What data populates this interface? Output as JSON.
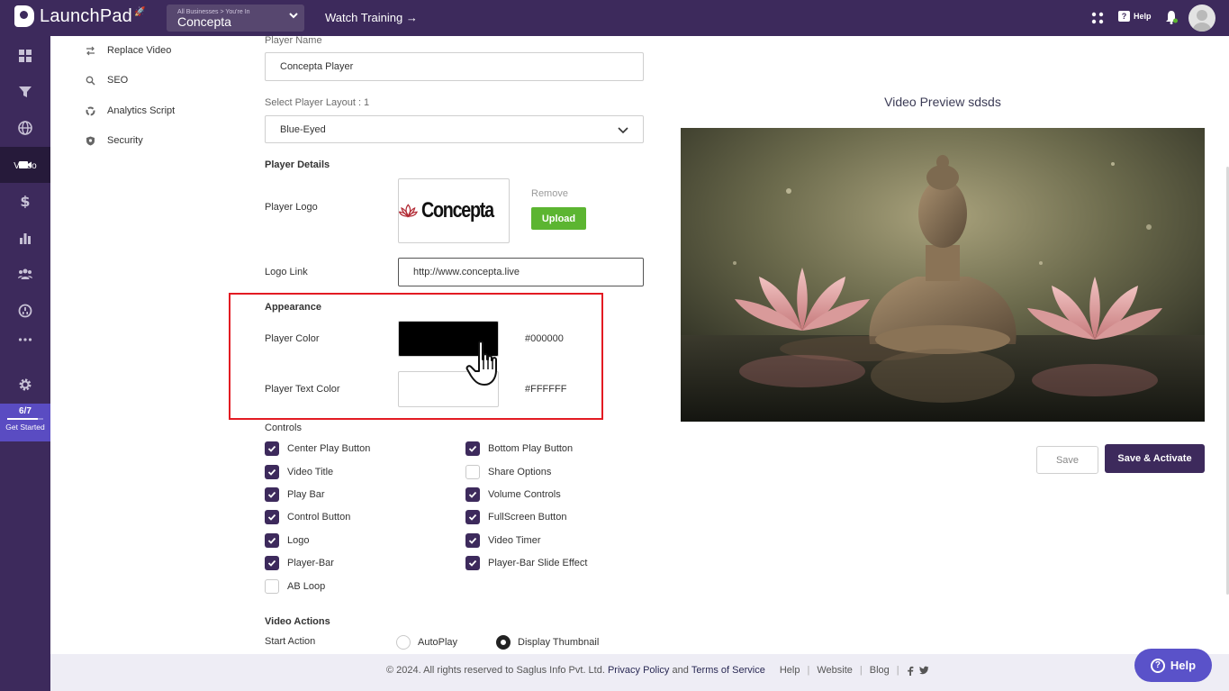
{
  "topbar": {
    "app_name": "LaunchPad",
    "business_switcher": {
      "caption": "All Businesses > You're In",
      "current": "Concepta"
    },
    "watch_training": "Watch Training →",
    "help_label": "Help"
  },
  "rail": {
    "active_label": "Video",
    "progress": {
      "fraction": "6/7",
      "value": 0.857,
      "label": "Get Started"
    }
  },
  "submenu": [
    {
      "label": "Replace Video",
      "icon": "swap-icon"
    },
    {
      "label": "SEO",
      "icon": "search-icon"
    },
    {
      "label": "Analytics Script",
      "icon": "analytics-icon"
    },
    {
      "label": "Security",
      "icon": "shield-icon"
    }
  ],
  "form": {
    "player_name_label": "Player Name",
    "player_name_value": "Concepta Player",
    "layout_label": "Select Player Layout : 1",
    "layout_value": "Blue-Eyed",
    "player_details": "Player Details",
    "player_logo_label": "Player Logo",
    "logo_brand": "Concepta",
    "remove": "Remove",
    "upload": "Upload",
    "logo_link_label": "Logo Link",
    "logo_link_value": "http://www.concepta.live",
    "appearance": "Appearance",
    "player_color_label": "Player Color",
    "player_color_value": "#000000",
    "player_text_color_label": "Player Text Color",
    "player_text_color_value": "#FFFFFF",
    "controls_heading": "Controls",
    "controls_left": [
      {
        "label": "Center Play Button",
        "checked": true
      },
      {
        "label": "Video Title",
        "checked": true
      },
      {
        "label": "Play Bar",
        "checked": true
      },
      {
        "label": "Control Button",
        "checked": true
      },
      {
        "label": "Logo",
        "checked": true
      },
      {
        "label": "Player-Bar",
        "checked": true
      },
      {
        "label": "AB Loop",
        "checked": false
      }
    ],
    "controls_right": [
      {
        "label": "Bottom Play Button",
        "checked": true
      },
      {
        "label": "Share Options",
        "checked": false
      },
      {
        "label": "Volume Controls",
        "checked": true
      },
      {
        "label": "FullScreen Button",
        "checked": true
      },
      {
        "label": "Video Timer",
        "checked": true
      },
      {
        "label": "Player-Bar Slide Effect",
        "checked": true
      }
    ],
    "video_actions": "Video Actions",
    "start_action_label": "Start Action",
    "start_action_options": [
      {
        "label": "AutoPlay",
        "selected": false
      },
      {
        "label": "Display Thumbnail",
        "selected": true
      }
    ]
  },
  "preview": {
    "title": "Video Preview sdsds",
    "save": "Save",
    "save_activate": "Save & Activate"
  },
  "footer": {
    "copyright": "©  2024. All rights reserved to Saglus Info Pvt. Ltd.",
    "privacy": "Privacy Policy",
    "and": "and",
    "terms": "Terms of Service",
    "links": [
      "Help",
      "Website",
      "Blog"
    ],
    "help_fab": "Help"
  },
  "colors": {
    "brand": "#3d2a5c",
    "upload": "#5cb531",
    "highlight": "#e31b23",
    "fab": "#5a52c9"
  }
}
